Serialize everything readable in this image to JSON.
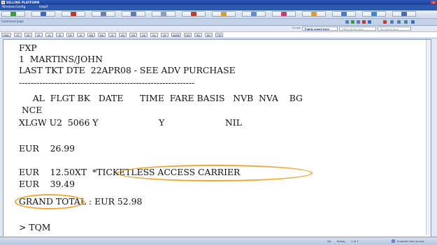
{
  "window": {
    "title": "SELLING PLATFORM"
  },
  "menu": {
    "items": [
      "Window",
      "Config",
      "Help"
    ]
  },
  "toolbar": {
    "buttons": [
      {
        "icon": "green-arrow-icon",
        "color": "#3c9a3c"
      },
      {
        "icon": "globe-icon",
        "color": "#3a6bc8"
      },
      {
        "icon": "red-arrow-icon",
        "color": "#c03a2a"
      },
      {
        "icon": "car-icon",
        "color": "#6a7ea8"
      },
      {
        "icon": "plane-icon",
        "color": "#5d7ab8"
      },
      {
        "icon": "hotel-icon",
        "color": "#8c9ec2"
      },
      {
        "icon": "ticket-icon",
        "color": "#c83a2a"
      },
      {
        "icon": "pen-icon",
        "color": "#d6a030"
      },
      {
        "icon": "people-icon",
        "color": "#5a8ed0"
      },
      {
        "icon": "heart-icon",
        "color": "#c83a6a"
      },
      {
        "icon": "cart-icon",
        "color": "#d6a030"
      },
      {
        "icon": "document-icon",
        "color": "#4a7ac8"
      },
      {
        "icon": "phone-icon",
        "color": "#3a8ac8"
      },
      {
        "icon": "pin-icon",
        "color": "#4a6ab0"
      }
    ]
  },
  "command_bar": {
    "label": "Command page"
  },
  "smart_keys": {
    "label": "Simple",
    "tabs": [
      "Public smart keys",
      "Office smart keys",
      "My smart keys"
    ]
  },
  "keys": [
    "CANC",
    "ET",
    "ER",
    "RT",
    "IG",
    "IR",
    "TKT",
    "IE",
    "MD",
    "MU",
    "QT",
    "GG",
    "GR",
    "GK",
    "RL",
    "RP",
    "ANMK",
    "FXX",
    "RD",
    "RH",
    "TTP"
  ],
  "terminal": {
    "lines": [
      "FXP",
      "1  MARTINS/JOHN",
      "LAST TKT DTE  22APR08 - SEE ADV PURCHASE",
      "------------------------------------------------------------",
      "     AL  FLGT BK   DATE      TIME  FARE BASIS   NVB  NVA    BG",
      " NCE",
      "XLGW U2  5066 Y                      Y                      NIL",
      "",
      "EUR    26.99",
      "",
      "EUR    12.50XT  *TICKETLESS ACCESS CARRIER",
      "EUR    39.49",
      "GRAND TOTAL : EUR 52.98",
      "",
      "> TQM"
    ],
    "highlight_color": "#f3a532"
  },
  "status_bar": {
    "items": [
      "Dis",
      "Ready",
      "1 of 1"
    ],
    "connection": "Enabled host access"
  }
}
